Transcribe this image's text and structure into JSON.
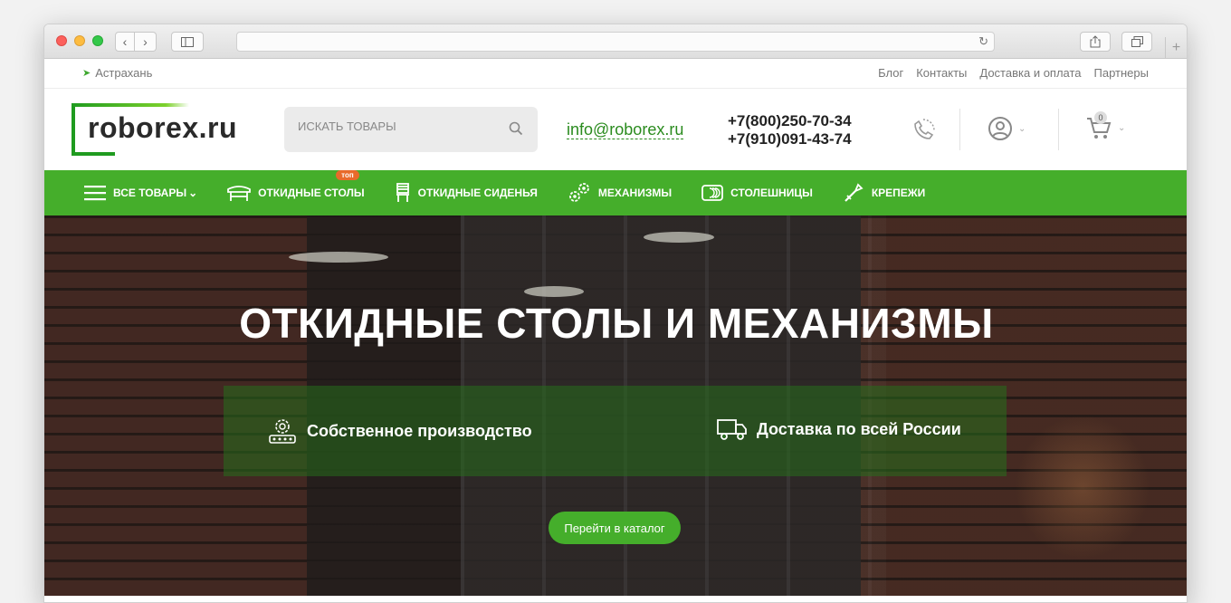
{
  "browser": {
    "url": ""
  },
  "topbar": {
    "city": "Астрахань",
    "links": [
      "Блог",
      "Контакты",
      "Доставка и оплата",
      "Партнеры"
    ]
  },
  "header": {
    "logo": "roborex.ru",
    "search_placeholder": "ИСКАТЬ ТОВАРЫ",
    "email": "info@roborex.ru",
    "phone1": "+7(800)250-70-34",
    "phone2": "+7(910)091-43-74",
    "cart_count": "0"
  },
  "menu": {
    "items": [
      {
        "label": "ВСЕ ТОВАРЫ",
        "icon": "hamburger-icon"
      },
      {
        "label": "ОТКИДНЫЕ СТОЛЫ",
        "icon": "table-icon",
        "badge": "топ"
      },
      {
        "label": "ОТКИДНЫЕ СИДЕНЬЯ",
        "icon": "chair-icon"
      },
      {
        "label": "МЕХАНИЗМЫ",
        "icon": "gears-icon"
      },
      {
        "label": "СТОЛЕШНИЦЫ",
        "icon": "tabletop-icon"
      },
      {
        "label": "КРЕПЕЖИ",
        "icon": "tools-icon"
      }
    ]
  },
  "hero": {
    "title": "ОТКИДНЫЕ СТОЛЫ И МЕХАНИЗМЫ",
    "feature1": "Собственное производство",
    "feature2": "Доставка по всей России",
    "cta": "Перейти в каталог"
  },
  "colors": {
    "brand_green": "#45ae2b",
    "dark_green": "#1f9b1f",
    "badge_orange": "#e86a2b"
  }
}
